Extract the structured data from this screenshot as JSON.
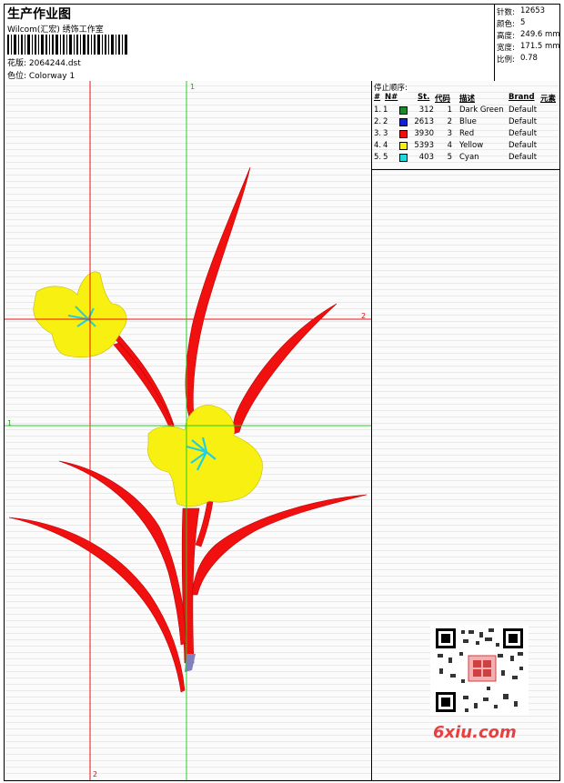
{
  "header": {
    "title": "生产作业图",
    "studio": "Wilcom(汇宏) 绣饰工作室",
    "design": "花版:  2064244.dst",
    "colorway": "色位:  Colorway 1"
  },
  "stats": [
    {
      "label": "针数:",
      "value": "12653"
    },
    {
      "label": "颜色:",
      "value": "5"
    },
    {
      "label": "高度:",
      "value": "249.6 mm"
    },
    {
      "label": "宽度:",
      "value": "171.5 mm"
    },
    {
      "label": "比例:",
      "value": "0.78"
    }
  ],
  "stop_sequence": {
    "title": "停止顺序:",
    "headers": {
      "num": "#",
      "no": "N#",
      "st": "St.",
      "code": "代码",
      "desc": "描述",
      "brand": "Brand",
      "elem": "元素"
    },
    "rows": [
      {
        "num": "1.",
        "no": "1",
        "st": "312",
        "code": "1",
        "desc": "Dark Green",
        "brand": "Default",
        "color": "#1a8a2a"
      },
      {
        "num": "2.",
        "no": "2",
        "st": "2613",
        "code": "2",
        "desc": "Blue",
        "brand": "Default",
        "color": "#1020e0"
      },
      {
        "num": "3.",
        "no": "3",
        "st": "3930",
        "code": "3",
        "desc": "Red",
        "brand": "Default",
        "color": "#ee1010"
      },
      {
        "num": "4.",
        "no": "4",
        "st": "5393",
        "code": "4",
        "desc": "Yellow",
        "brand": "Default",
        "color": "#f5f010"
      },
      {
        "num": "5.",
        "no": "5",
        "st": "403",
        "code": "5",
        "desc": "Cyan",
        "brand": "Default",
        "color": "#20d8e0"
      }
    ]
  },
  "guides": {
    "green_top": "1",
    "red_right": "2",
    "green_left": "1",
    "red_bottom": "2"
  },
  "brand_text": "6xiu.com",
  "colors": {
    "red": "#f01010",
    "green": "#20d020",
    "yellow": "#f8f010",
    "cyan": "#20d0e0"
  }
}
